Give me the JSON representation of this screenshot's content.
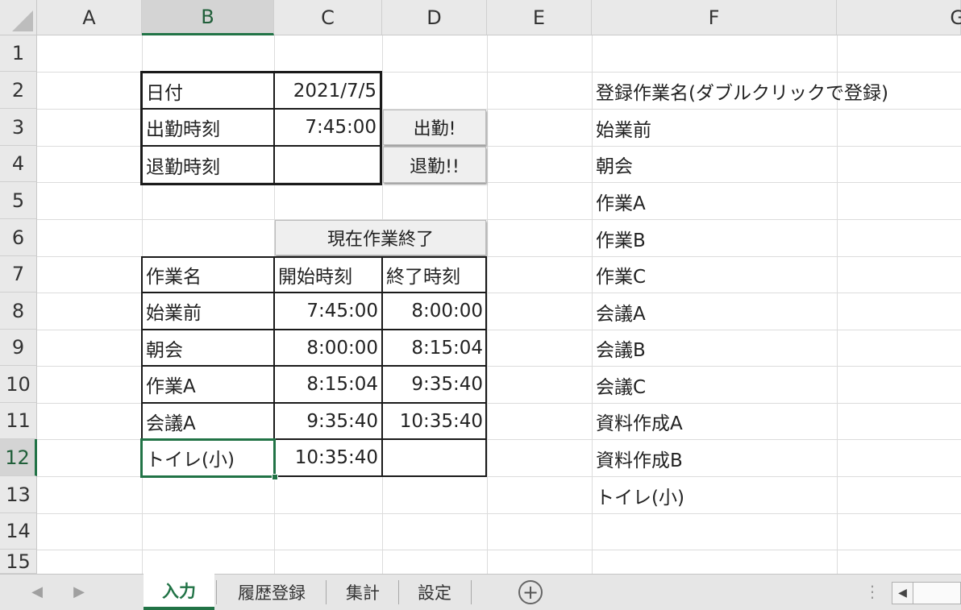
{
  "columns": [
    "A",
    "B",
    "C",
    "D",
    "E",
    "F",
    "G"
  ],
  "rows": [
    "1",
    "2",
    "3",
    "4",
    "5",
    "6",
    "7",
    "8",
    "9",
    "10",
    "11",
    "12",
    "13",
    "14",
    "15"
  ],
  "selected_cell": {
    "column": "B",
    "row": "12"
  },
  "info_table": {
    "date_label": "日付",
    "date_value": "2021/7/5",
    "clockin_label": "出勤時刻",
    "clockin_value": "7:45:00",
    "clockout_label": "退勤時刻",
    "clockout_value": ""
  },
  "buttons": {
    "clock_in": "出勤!",
    "clock_out": "退勤!!",
    "finish_task": "現在作業終了"
  },
  "work_log": {
    "headers": [
      "作業名",
      "開始時刻",
      "終了時刻"
    ],
    "rows": [
      [
        "始業前",
        "7:45:00",
        "8:00:00"
      ],
      [
        "朝会",
        "8:00:00",
        "8:15:04"
      ],
      [
        "作業A",
        "8:15:04",
        "9:35:40"
      ],
      [
        "会議A",
        "9:35:40",
        "10:35:40"
      ],
      [
        "トイレ(小)",
        "10:35:40",
        ""
      ]
    ]
  },
  "task_list": {
    "header": "登録作業名(ダブルクリックで登録)",
    "items": [
      "始業前",
      "朝会",
      "作業A",
      "作業B",
      "作業C",
      "会議A",
      "会議B",
      "会議C",
      "資料作成A",
      "資料作成B",
      "トイレ(小)"
    ]
  },
  "sheet_tabs": [
    "入力",
    "履歴登録",
    "集計",
    "設定"
  ],
  "active_tab": "入力",
  "colors": {
    "accent": "#217346"
  }
}
